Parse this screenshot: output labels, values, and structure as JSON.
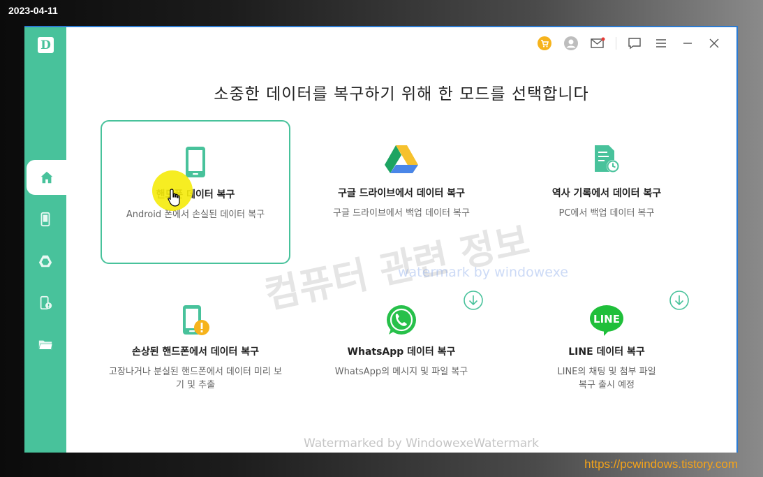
{
  "overlay": {
    "date": "2023-04-11",
    "blog_url": "https://pcwindows.tistory.com"
  },
  "app": {
    "logo_letter": "D",
    "page_title": "소중한 데이터를 복구하기 위해 한 모드를 선택합니다"
  },
  "sidebar": {
    "items": [
      {
        "name": "home",
        "icon": "home-icon"
      },
      {
        "name": "phone",
        "icon": "phone-icon"
      },
      {
        "name": "google-drive",
        "icon": "drive-icon"
      },
      {
        "name": "broken-phone",
        "icon": "broken-phone-icon"
      },
      {
        "name": "folder",
        "icon": "folder-icon"
      }
    ],
    "active": "home"
  },
  "topbar": {
    "icons": [
      "cart-icon",
      "user-icon",
      "mail-icon",
      "feedback-icon",
      "menu-icon",
      "minimize-icon",
      "close-icon"
    ]
  },
  "modes": [
    {
      "title": "핸드폰 데이터 복구",
      "desc": "Android 폰에서 손실된 데이터 복구",
      "icon": "phone-icon",
      "selected": true
    },
    {
      "title": "구글 드라이브에서 데이터 복구",
      "desc": "구글 드라이브에서 백업 데이터 복구",
      "icon": "google-drive-icon"
    },
    {
      "title": "역사 기록에서 데이터 복구",
      "desc": "PC에서 백업 데이터 복구",
      "icon": "history-file-icon"
    },
    {
      "title": "손상된 핸드폰에서 데이터 복구",
      "desc": "고장나거나 분실된 핸드폰에서 데이터 미리 보기 및 추출",
      "icon": "broken-phone-icon"
    },
    {
      "title": "WhatsApp 데이터 복구",
      "desc": "WhatsApp의 메시지 및 파일 복구",
      "icon": "whatsapp-icon",
      "download": true
    },
    {
      "title": "LINE 데이터 복구",
      "desc": "LINE의 채팅 및 첨부 파일 복구 출시 예정",
      "icon": "line-icon",
      "icon_text": "LINE",
      "download": true
    }
  ],
  "watermarks": {
    "korean": "컴퓨터 관련 정보",
    "english": "watermark by windowexe",
    "bottom": "Watermarked by WindowexeWatermark"
  },
  "colors": {
    "accent": "#48c29b",
    "title_text": "#222222",
    "desc_text": "#666666",
    "cart": "#f6b31c",
    "warning": "#f6b31c",
    "whatsapp": "#27c04a",
    "line": "#1fbf3a",
    "window_border": "#2b7bd3"
  }
}
